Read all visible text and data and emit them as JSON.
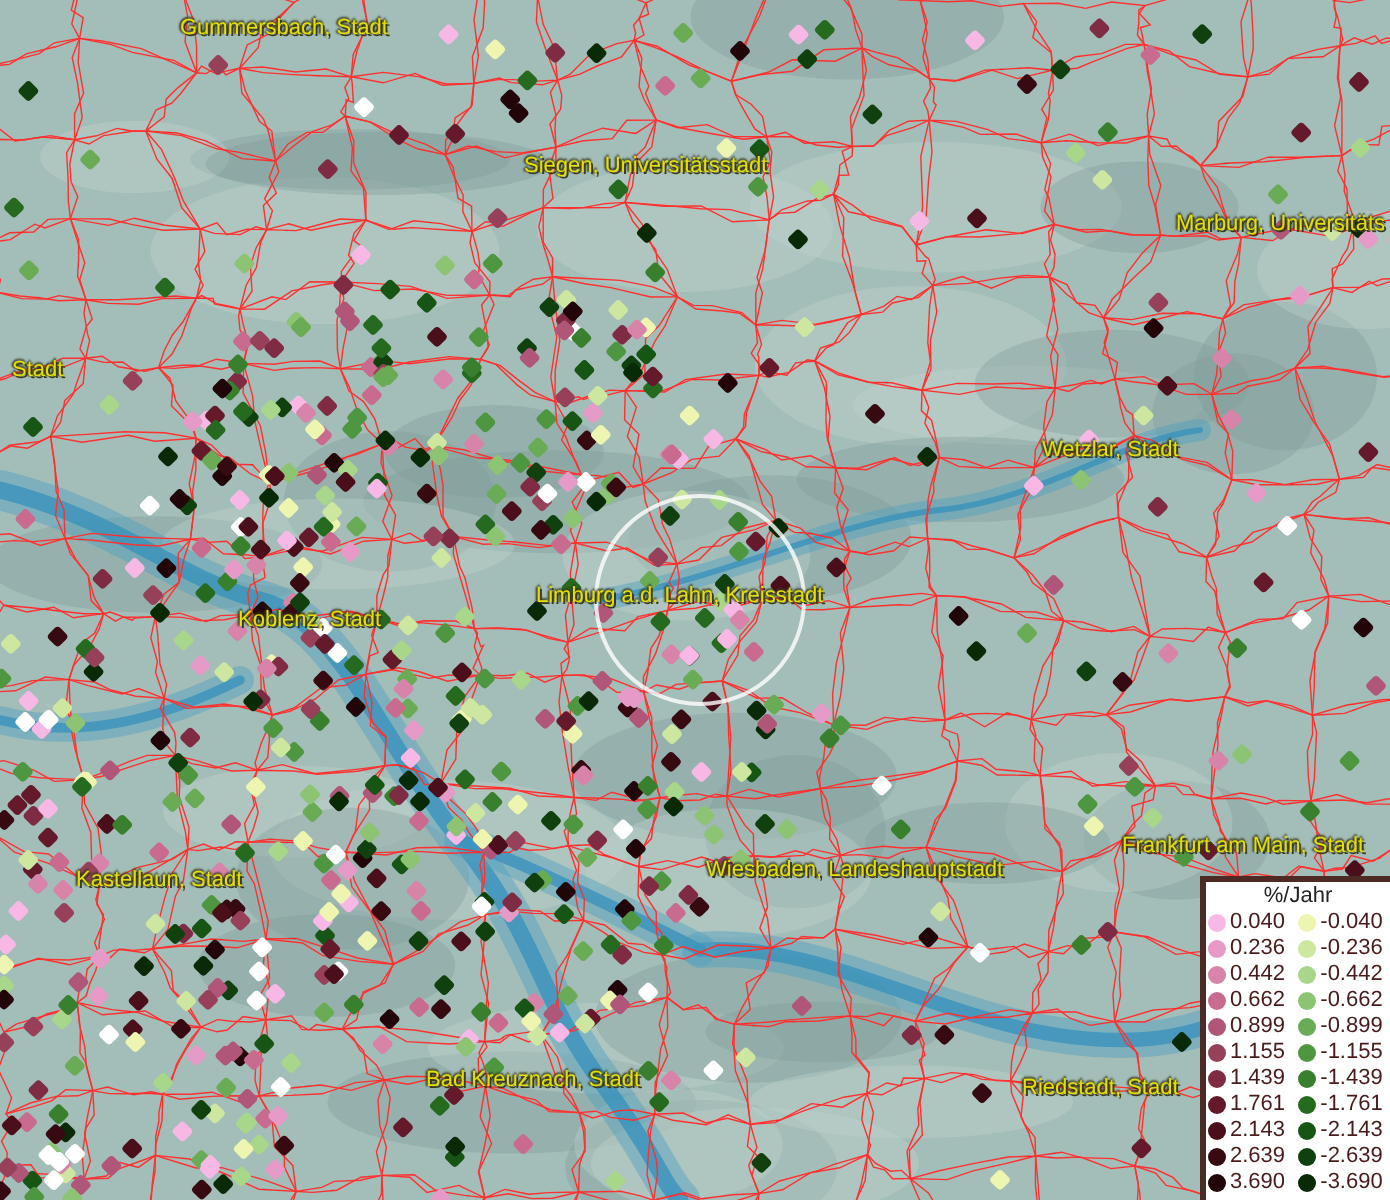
{
  "map": {
    "labels": [
      {
        "text": "Gummersbach, Stadt"
      },
      {
        "text": "Siegen, Universitätsstadt"
      },
      {
        "text": "Marburg, Universitäts"
      },
      {
        "text": "Stadt"
      },
      {
        "text": "Wetzlar, Stadt"
      },
      {
        "text": "Limburg a.d. Lahn, Kreisstadt"
      },
      {
        "text": "Koblenz, Stadt"
      },
      {
        "text": "Frankfurt am Main, Stadt"
      },
      {
        "text": "Kastellaun, Stadt"
      },
      {
        "text": "Wiesbaden, Landeshauptstadt"
      },
      {
        "text": "Bad Kreuznach, Stadt"
      },
      {
        "text": "Riedstadt, Stadt"
      }
    ]
  },
  "legend": {
    "title": "%/Jahr",
    "items": [
      {
        "value": "0.040",
        "color": "#f7b8e6"
      },
      {
        "value": "-0.040",
        "color": "#eef5b0"
      },
      {
        "value": "0.236",
        "color": "#e69ac8"
      },
      {
        "value": "-0.236",
        "color": "#cde6a0"
      },
      {
        "value": "0.442",
        "color": "#d783aa"
      },
      {
        "value": "-0.442",
        "color": "#a8d68a"
      },
      {
        "value": "0.662",
        "color": "#c86b8f"
      },
      {
        "value": "-0.662",
        "color": "#8cc473"
      },
      {
        "value": "0.899",
        "color": "#b05678"
      },
      {
        "value": "-0.899",
        "color": "#6aab55"
      },
      {
        "value": "1.155",
        "color": "#96405a"
      },
      {
        "value": "-1.155",
        "color": "#4e9640"
      },
      {
        "value": "1.439",
        "color": "#7e2b43"
      },
      {
        "value": "-1.439",
        "color": "#38802e"
      },
      {
        "value": "1.761",
        "color": "#641a2a"
      },
      {
        "value": "-1.761",
        "color": "#266a20"
      },
      {
        "value": "2.143",
        "color": "#4a0f1a"
      },
      {
        "value": "-2.143",
        "color": "#175514"
      },
      {
        "value": "2.639",
        "color": "#360a10"
      },
      {
        "value": "-2.639",
        "color": "#0f400d"
      },
      {
        "value": "3.690",
        "color": "#220508"
      },
      {
        "value": "-3.690",
        "color": "#082a06"
      }
    ]
  }
}
